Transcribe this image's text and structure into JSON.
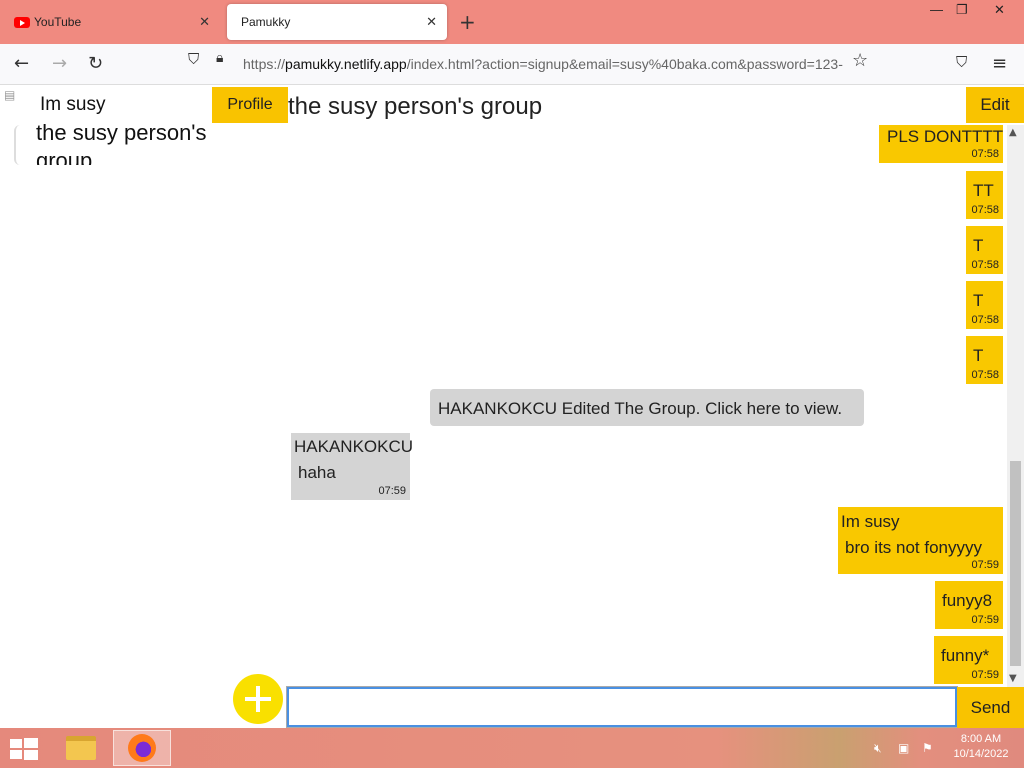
{
  "browser": {
    "tabs": [
      {
        "title": "YouTube",
        "active": false
      },
      {
        "title": "Pamukky",
        "active": true
      }
    ],
    "url_prefix": "https://",
    "url_host": "pamukky.netlify.app",
    "url_path": "/index.html?action=signup&email=susy%40baka.com&password=123-"
  },
  "sidebar": {
    "name": "Im susy",
    "group_name": "the susy person's group"
  },
  "header": {
    "profile_label": "Profile",
    "group_title": "the susy person's group",
    "edit_label": "Edit"
  },
  "messages": [
    {
      "text": "PLS DONTTTT",
      "time": "07:58"
    },
    {
      "text": "TT",
      "time": "07:58"
    },
    {
      "text": "T",
      "time": "07:58"
    },
    {
      "text": "T",
      "time": "07:58"
    },
    {
      "text": "T",
      "time": "07:58"
    },
    {
      "system": "HAKANKOKCU Edited The Group. Click here to view."
    },
    {
      "sender": "HAKANKOKCU",
      "text": "haha",
      "time": "07:59"
    },
    {
      "sender": "Im susy",
      "text": "bro its not fonyyyy",
      "time": "07:59"
    },
    {
      "text": "funyy8",
      "time": "07:59"
    },
    {
      "text": "funny*",
      "time": "07:59"
    }
  ],
  "composer": {
    "value": "",
    "send_label": "Send"
  },
  "taskbar": {
    "time": "8:00 AM",
    "date": "10/14/2022"
  }
}
